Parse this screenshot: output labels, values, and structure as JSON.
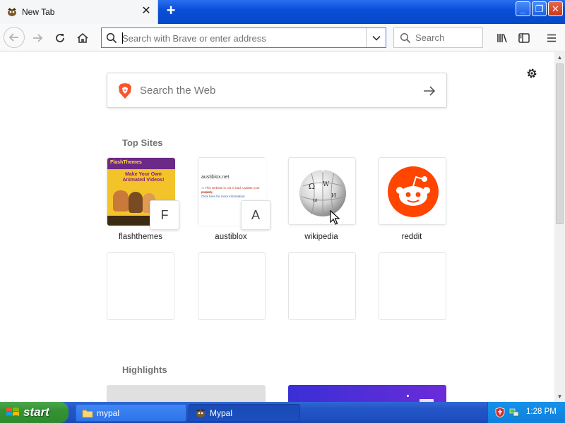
{
  "tab": {
    "title": "New Tab",
    "close": "✕"
  },
  "new_tab": "+",
  "window": {
    "minimize": "_",
    "maximize": "❐",
    "close": "✕"
  },
  "urlbar": {
    "placeholder": "Search with Brave or enter address"
  },
  "searchbar": {
    "placeholder": "Search"
  },
  "web_search": {
    "placeholder": "Search the Web"
  },
  "sections": {
    "top_sites": "Top Sites",
    "highlights": "Highlights"
  },
  "top_sites": [
    {
      "label": "flashthemes",
      "letter": "F"
    },
    {
      "label": "austiblox",
      "letter": "A"
    },
    {
      "label": "wikipedia"
    },
    {
      "label": "reddit"
    }
  ],
  "austiblox_thumb": {
    "domain": "austiblox.net",
    "lines": [
      "⚠ This website is not in bad. Update your version",
      "properly",
      "Click here for more information"
    ]
  },
  "flash_thumb": {
    "banner": "Make Your Own Animated Videos!"
  },
  "taskbar": {
    "start": "start",
    "items": [
      {
        "label": "mypal"
      },
      {
        "label": "Mypal"
      }
    ],
    "clock": "1:28 PM"
  },
  "colors": {
    "accent": "#0a84ff",
    "reddit": "#ff4500",
    "brave": "#fb542b",
    "highlight_purple": "#5b2bd8"
  }
}
